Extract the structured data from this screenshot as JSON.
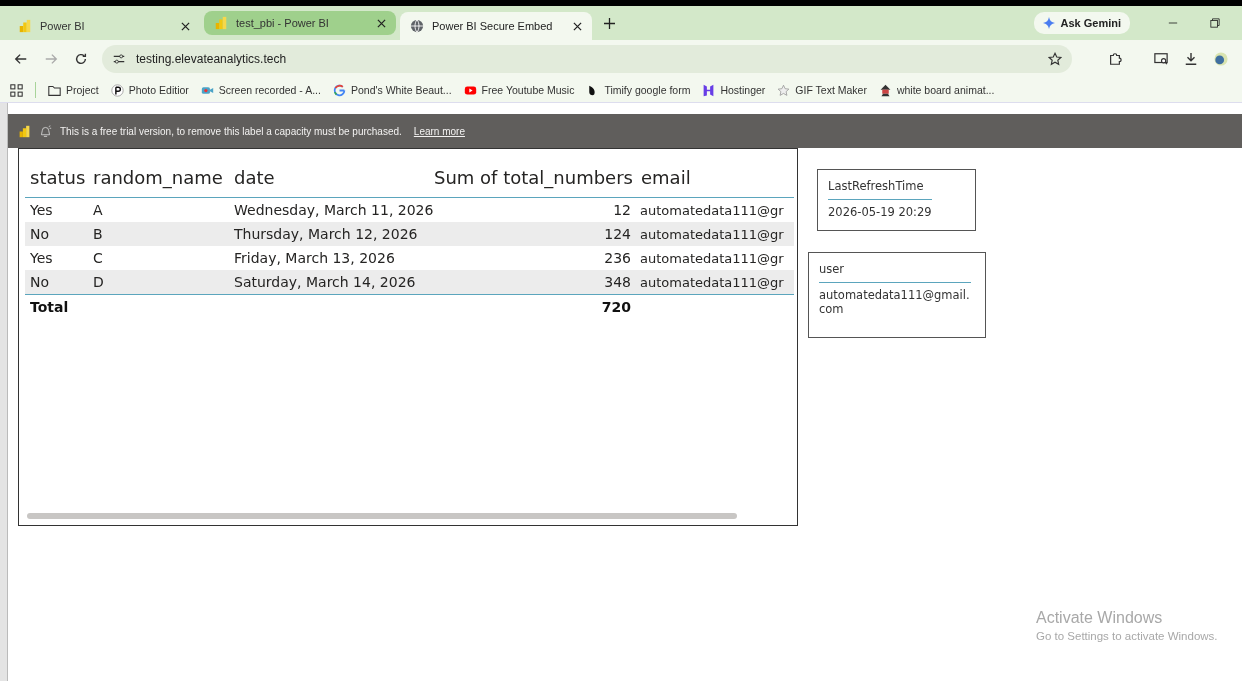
{
  "browser": {
    "tabs": [
      {
        "title": "Power BI",
        "selected": false
      },
      {
        "title": "test_pbi - Power BI",
        "selected": false
      },
      {
        "title": "Power BI Secure Embed",
        "selected": true
      }
    ],
    "gemini": "Ask Gemini",
    "url": "testing.elevateanalytics.tech",
    "bookmarks": [
      {
        "label": "Project"
      },
      {
        "label": "Photo Editior"
      },
      {
        "label": "Screen recorded - A..."
      },
      {
        "label": "Pond's White Beaut..."
      },
      {
        "label": "Free Youtube Music"
      },
      {
        "label": "Timify google form"
      },
      {
        "label": "Hostinger"
      },
      {
        "label": "GIF Text Maker"
      },
      {
        "label": "white board animat..."
      }
    ]
  },
  "banner": {
    "text": "This is a free trial version, to remove this label a capacity must be purchased.",
    "link": "Learn more"
  },
  "table": {
    "columns": [
      "status",
      "random_name",
      "date",
      "Sum of total_numbers",
      "email"
    ],
    "rows": [
      [
        "Yes",
        "A",
        "Wednesday, March 11, 2026",
        "12",
        "automatedata111@gr"
      ],
      [
        "No",
        "B",
        "Thursday, March 12, 2026",
        "124",
        "automatedata111@gr"
      ],
      [
        "Yes",
        "C",
        "Friday, March 13, 2026",
        "236",
        "automatedata111@gr"
      ],
      [
        "No",
        "D",
        "Saturday, March 14, 2026",
        "348",
        "automatedata111@gr"
      ]
    ],
    "total": {
      "label": "Total",
      "value": "720"
    }
  },
  "cards": [
    {
      "title": "LastRefreshTime",
      "value": "2026-05-19 20:29"
    },
    {
      "title": "user",
      "value": "automatedata111@gmail.com"
    }
  ],
  "os_notice": {
    "title": "Activate Windows",
    "subtitle": "Go to Settings to activate Windows."
  }
}
